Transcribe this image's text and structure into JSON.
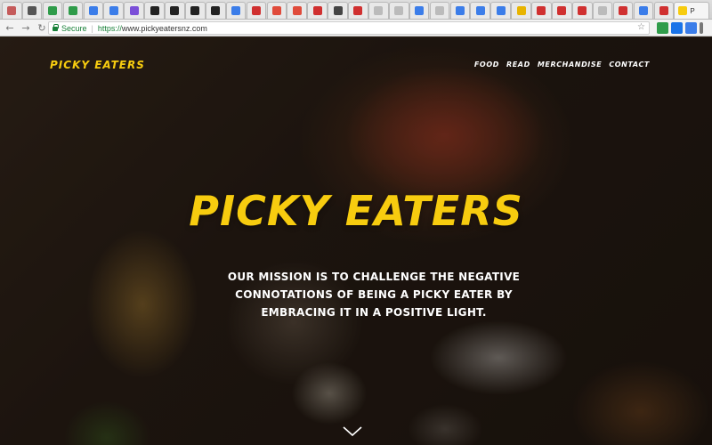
{
  "browser": {
    "active_tab_title": "P",
    "url_secure_label": "Secure",
    "url_scheme": "https://",
    "url_host": "www.pickyeatersnz.com",
    "tab_favicon_colors": [
      "#c55b5b",
      "#555555",
      "#2f9c4a",
      "#2f9c4a",
      "#3b7de9",
      "#3b7de9",
      "#7b4fd8",
      "#222222",
      "#222222",
      "#222222",
      "#222222",
      "#3b7de9",
      "#d03030",
      "#e04b3b",
      "#e04b3b",
      "#d03030",
      "#444444",
      "#d03030",
      "#bbbbbb",
      "#bbbbbb",
      "#3b7de9",
      "#bbbbbb",
      "#3b7de9",
      "#3b7de9",
      "#3b7de9",
      "#e8b400",
      "#d03030",
      "#d03030",
      "#d03030",
      "#bbbbbb",
      "#d03030",
      "#3b7de9",
      "#d03030"
    ],
    "extension_colors": [
      "#2f9c4a",
      "#1a73e8",
      "#3b7de9",
      "#d03030"
    ]
  },
  "site": {
    "brand": "PICKY EATERS",
    "nav": [
      "FOOD",
      "READ",
      "MERCHANDISE",
      "CONTACT"
    ],
    "hero_title": "PICKY EATERS",
    "mission": "OUR MISSION IS TO CHALLENGE THE NEGATIVE CONNOTATIONS OF BEING A PICKY EATER BY EMBRACING IT IN A POSITIVE LIGHT.",
    "accent_color": "#f7cc0f",
    "scroll_icon": "chevron-down-icon"
  }
}
